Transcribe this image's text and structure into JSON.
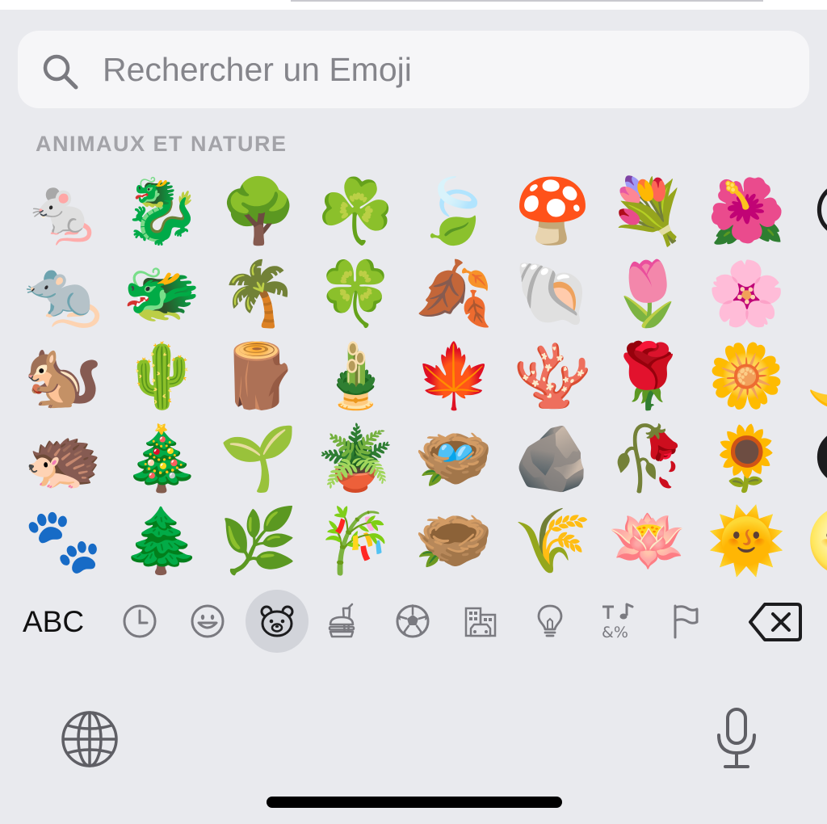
{
  "search": {
    "placeholder": "Rechercher un Emoji",
    "value": ""
  },
  "section": {
    "title": "ANIMAUX ET NATURE"
  },
  "emoji_grid": [
    [
      "🐁",
      "🐉",
      "🌳",
      "☘️",
      "🍃",
      "🍄",
      "💐",
      "🌺",
      "🌕"
    ],
    [
      "🐀",
      "🐲",
      "🌴",
      "🍀",
      "🍂",
      "🐚",
      "🌷",
      "🌸",
      ""
    ],
    [
      "🐿️",
      "🌵",
      "🪵",
      "🎍",
      "🍁",
      "🪸",
      "🌹",
      "🌼",
      "🌙"
    ],
    [
      "🦔",
      "🎄",
      "🌱",
      "🪴",
      "🪺",
      "🪨",
      "🥀",
      "🌻",
      "🌑"
    ],
    [
      "🐾",
      "🌲",
      "🌿",
      "🎋",
      "🪹",
      "🌾",
      "🪷",
      "🌞",
      "🌝"
    ]
  ],
  "category_bar": {
    "abc_label": "ABC",
    "categories": [
      {
        "name": "recents",
        "icon": "clock-icon"
      },
      {
        "name": "smileys",
        "icon": "smiley-icon"
      },
      {
        "name": "animals-nature",
        "icon": "bear-icon",
        "active": true
      },
      {
        "name": "food",
        "icon": "burger-drink-icon"
      },
      {
        "name": "activity",
        "icon": "soccer-ball-icon"
      },
      {
        "name": "travel",
        "icon": "building-car-icon"
      },
      {
        "name": "objects",
        "icon": "lightbulb-icon"
      },
      {
        "name": "symbols",
        "icon": "symbols-icon"
      },
      {
        "name": "flags",
        "icon": "flag-icon"
      }
    ],
    "backspace_icon": "backspace-icon"
  },
  "bottom_bar": {
    "globe_icon": "globe-icon",
    "mic_icon": "microphone-icon"
  },
  "colors": {
    "keyboard_background": "#e9eaee",
    "search_background": "#f6f6f8",
    "active_category": "#d2d4da",
    "section_title": "#a3a3a8",
    "icon_gray": "#7a7a80"
  }
}
